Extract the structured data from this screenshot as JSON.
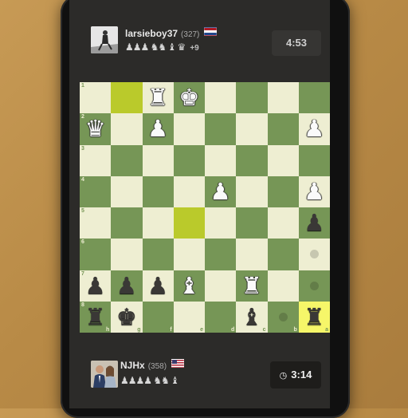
{
  "top_player": {
    "name": "larsieboy37",
    "rating": "(327)",
    "flag": "nl",
    "captured": "♟♟♟ ♞♞ ♝ ♛",
    "advantage": "+9",
    "clock": "4:53"
  },
  "bottom_player": {
    "name": "NJHx",
    "rating": "(358)",
    "flag": "us",
    "captured": "♟♟♟♟ ♞♞ ♝",
    "clock": "3:14",
    "clock_icon": "clock-icon"
  },
  "board": {
    "orientation": "black-bottom",
    "rank_labels": [
      "1",
      "2",
      "3",
      "4",
      "5",
      "6",
      "7",
      "8"
    ],
    "file_labels": [
      "h",
      "g",
      "f",
      "e",
      "d",
      "c",
      "b",
      "a"
    ],
    "rows": [
      [
        "",
        "",
        "wR",
        "wK",
        "",
        "",
        "",
        ""
      ],
      [
        "wQ",
        "",
        "wP",
        "",
        "",
        "",
        "",
        "wP"
      ],
      [
        "",
        "",
        "",
        "",
        "",
        "",
        "",
        ""
      ],
      [
        "",
        "",
        "",
        "",
        "wP",
        "",
        "",
        "wP"
      ],
      [
        "",
        "",
        "",
        "",
        "",
        "",
        "",
        "bP"
      ],
      [
        "",
        "",
        "",
        "",
        "",
        "",
        "",
        ""
      ],
      [
        "bP",
        "bP",
        "bP",
        "wB",
        "",
        "wR",
        "",
        ""
      ],
      [
        "bR",
        "bK",
        "",
        "",
        "",
        "bB",
        "",
        "bR"
      ]
    ],
    "highlights": [
      "0,1",
      "4,3",
      "7,7"
    ],
    "move_dots": [
      "5,7",
      "6,7",
      "7,6"
    ],
    "colors": {
      "light": "#eeeed2",
      "dark": "#769656",
      "highlight_light": "#f6f669",
      "highlight_dark": "#baca2b"
    }
  }
}
